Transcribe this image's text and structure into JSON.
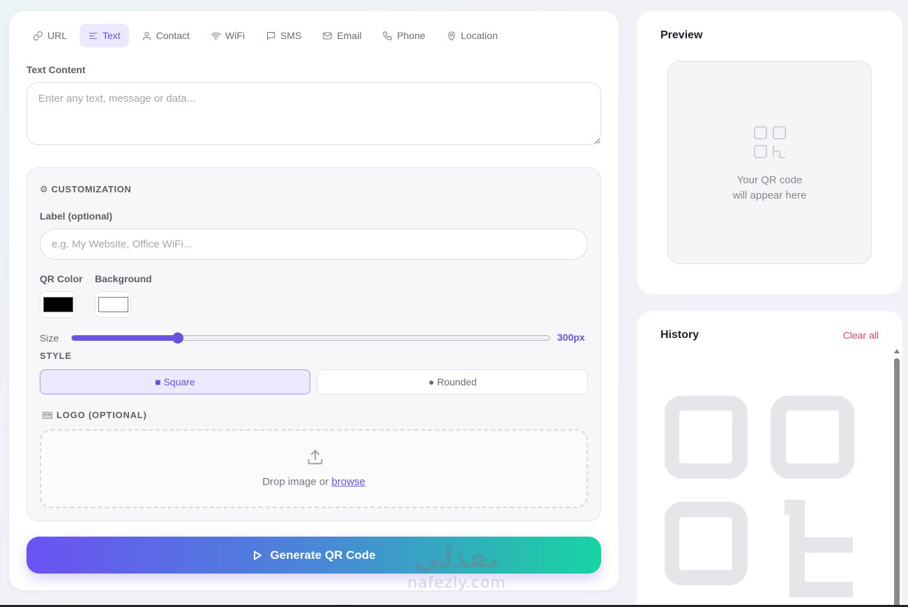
{
  "tabs": [
    {
      "label": "URL",
      "icon": "link-icon",
      "active": false
    },
    {
      "label": "Text",
      "icon": "text-lines-icon",
      "active": true
    },
    {
      "label": "Contact",
      "icon": "user-icon",
      "active": false
    },
    {
      "label": "WiFi",
      "icon": "wifi-icon",
      "active": false
    },
    {
      "label": "SMS",
      "icon": "chat-bubble-icon",
      "active": false
    },
    {
      "label": "Email",
      "icon": "envelope-icon",
      "active": false
    },
    {
      "label": "Phone",
      "icon": "phone-icon",
      "active": false
    },
    {
      "label": "Location",
      "icon": "map-pin-icon",
      "active": false
    }
  ],
  "text_content": {
    "label": "Text Content",
    "placeholder": "Enter any text, message or data...",
    "value": ""
  },
  "customization": {
    "title": "⚙ CUSTOMIZATION",
    "label_field": {
      "label": "Label (optional)",
      "placeholder": "e.g. My Website, Office WiFi...",
      "value": ""
    },
    "qr_color": {
      "label": "QR Color",
      "value": "#000000"
    },
    "background": {
      "label": "Background",
      "value": "#ffffff"
    },
    "size": {
      "label": "Size",
      "value_text": "300px",
      "value": 300,
      "min": 100,
      "max": 1000
    },
    "style": {
      "title": "STYLE",
      "square_label": "■ Square",
      "rounded_label": "● Rounded",
      "selected": "square"
    },
    "logo": {
      "title": "LOGO (OPTIONAL)",
      "drop_text": "Drop image or ",
      "browse_label": "browse"
    }
  },
  "generate_button": {
    "label": "Generate QR Code"
  },
  "preview": {
    "title": "Preview",
    "placeholder_line1": "Your QR code",
    "placeholder_line2": "will appear here"
  },
  "history": {
    "title": "History",
    "clear_label": "Clear all"
  },
  "watermark": {
    "arabic": "نفذلي",
    "latin": "nafezly.com"
  },
  "colors": {
    "accent": "#6a52e0",
    "accent_light": "#ece8fd",
    "danger": "#e0456a",
    "gradient_start": "#6b52f2",
    "gradient_end": "#19d4a2"
  }
}
